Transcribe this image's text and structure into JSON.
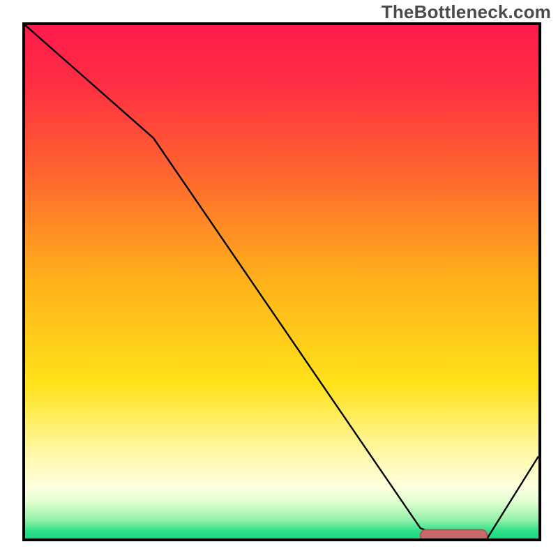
{
  "watermark": "TheBottleneck.com",
  "colors": {
    "border": "#000000",
    "curve": "#000000",
    "marker_fill": "#c76a6a",
    "marker_stroke": "#b05050",
    "gradient_stops": [
      {
        "offset": 0.0,
        "color": "#ff1a4b"
      },
      {
        "offset": 0.12,
        "color": "#ff2f43"
      },
      {
        "offset": 0.3,
        "color": "#ff6a2e"
      },
      {
        "offset": 0.5,
        "color": "#ffb21a"
      },
      {
        "offset": 0.7,
        "color": "#ffe21a"
      },
      {
        "offset": 0.82,
        "color": "#fff69a"
      },
      {
        "offset": 0.9,
        "color": "#ffffe0"
      },
      {
        "offset": 0.93,
        "color": "#dfffd0"
      },
      {
        "offset": 0.965,
        "color": "#8ef0a8"
      },
      {
        "offset": 0.985,
        "color": "#2fe08a"
      },
      {
        "offset": 1.0,
        "color": "#18d880"
      }
    ]
  },
  "chart_data": {
    "type": "line",
    "title": "",
    "xlabel": "",
    "ylabel": "",
    "xlim": [
      0,
      100
    ],
    "ylim": [
      0,
      100
    ],
    "grid": false,
    "legend": false,
    "series": [
      {
        "name": "curve",
        "x": [
          0,
          25,
          77,
          82,
          90,
          100
        ],
        "y": [
          100,
          78,
          2,
          0,
          0,
          16
        ]
      }
    ],
    "marker": {
      "x_start": 77,
      "x_end": 90,
      "y": 0.6,
      "thickness": 2.2
    }
  }
}
